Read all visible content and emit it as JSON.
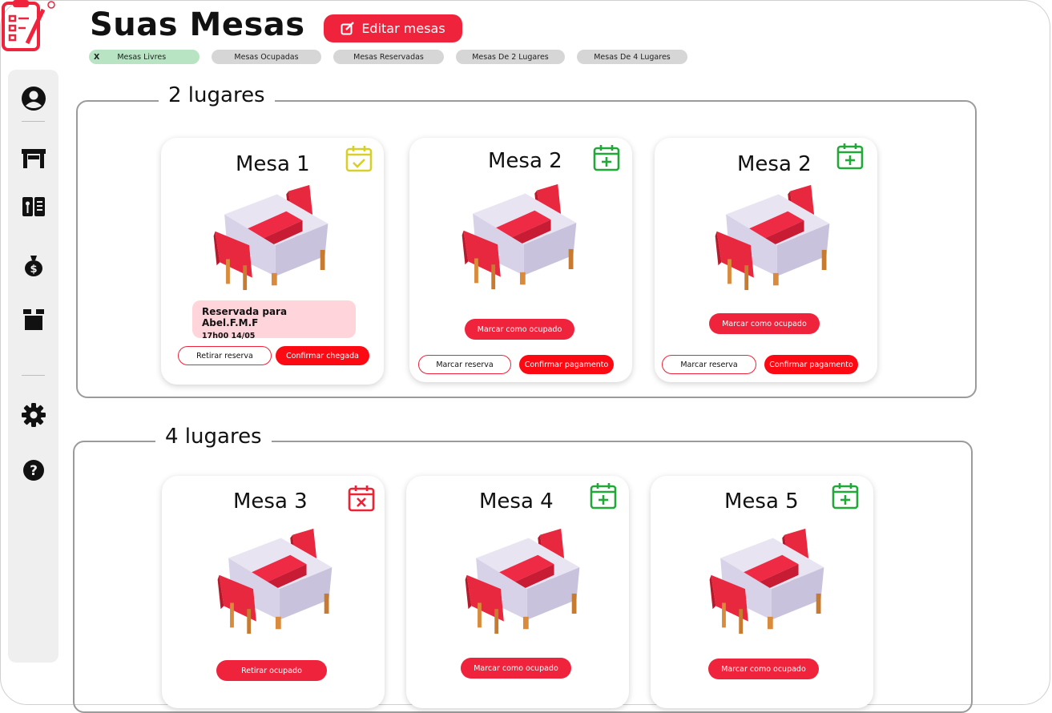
{
  "header": {
    "title": "Suas Mesas",
    "edit_label": "Editar mesas"
  },
  "filters": [
    {
      "label": "Mesas Livres",
      "active": true,
      "remove": "X"
    },
    {
      "label": "Mesas Ocupadas"
    },
    {
      "label": "Mesas Reservadas"
    },
    {
      "label": "Mesas De 2 Lugares"
    },
    {
      "label": "Mesas De 4 Lugares"
    }
  ],
  "sidebar": {
    "icons": [
      "profile-icon",
      "table-icon",
      "menu-icon",
      "money-bag-icon",
      "box-icon",
      "gear-icon",
      "help-icon"
    ]
  },
  "sections": [
    {
      "title": "2 lugares",
      "cards": [
        {
          "title": "Mesa 1",
          "status_icon": "calendar-check-icon",
          "status_color": "#d8cf2a",
          "reservation": {
            "name": "Reservada para Abel.F.M.F",
            "time": "17h00  14/05"
          },
          "left_button": "Retirar reserva",
          "right_button": "Confirmar chegada"
        },
        {
          "title": "Mesa 2",
          "status_icon": "calendar-plus-icon",
          "status_color": "#22a838",
          "main_button": "Marcar como ocupado",
          "left_button": "Marcar reserva",
          "right_button": "Confirmar pagamento"
        },
        {
          "title": "Mesa 2",
          "status_icon": "calendar-plus-icon",
          "status_color": "#22a838",
          "main_button": "Marcar como ocupado",
          "left_button": "Marcar reserva",
          "right_button": "Confirmar pagamento"
        }
      ]
    },
    {
      "title": "4 lugares",
      "cards": [
        {
          "title": "Mesa 3",
          "status_icon": "calendar-x-icon",
          "status_color": "#ee2233",
          "main_button": "Retirar ocupado"
        },
        {
          "title": "Mesa 4",
          "status_icon": "calendar-plus-icon",
          "status_color": "#22a838",
          "main_button": "Marcar como ocupado"
        },
        {
          "title": "Mesa 5",
          "status_icon": "calendar-plus-icon",
          "status_color": "#22a838",
          "main_button": "Marcar como ocupado"
        }
      ]
    }
  ],
  "colors": {
    "accent": "#ef233c",
    "confirm": "#fb0a14",
    "reserved_bg": "#ffd5db",
    "free_filter": "#b9e4c4"
  }
}
